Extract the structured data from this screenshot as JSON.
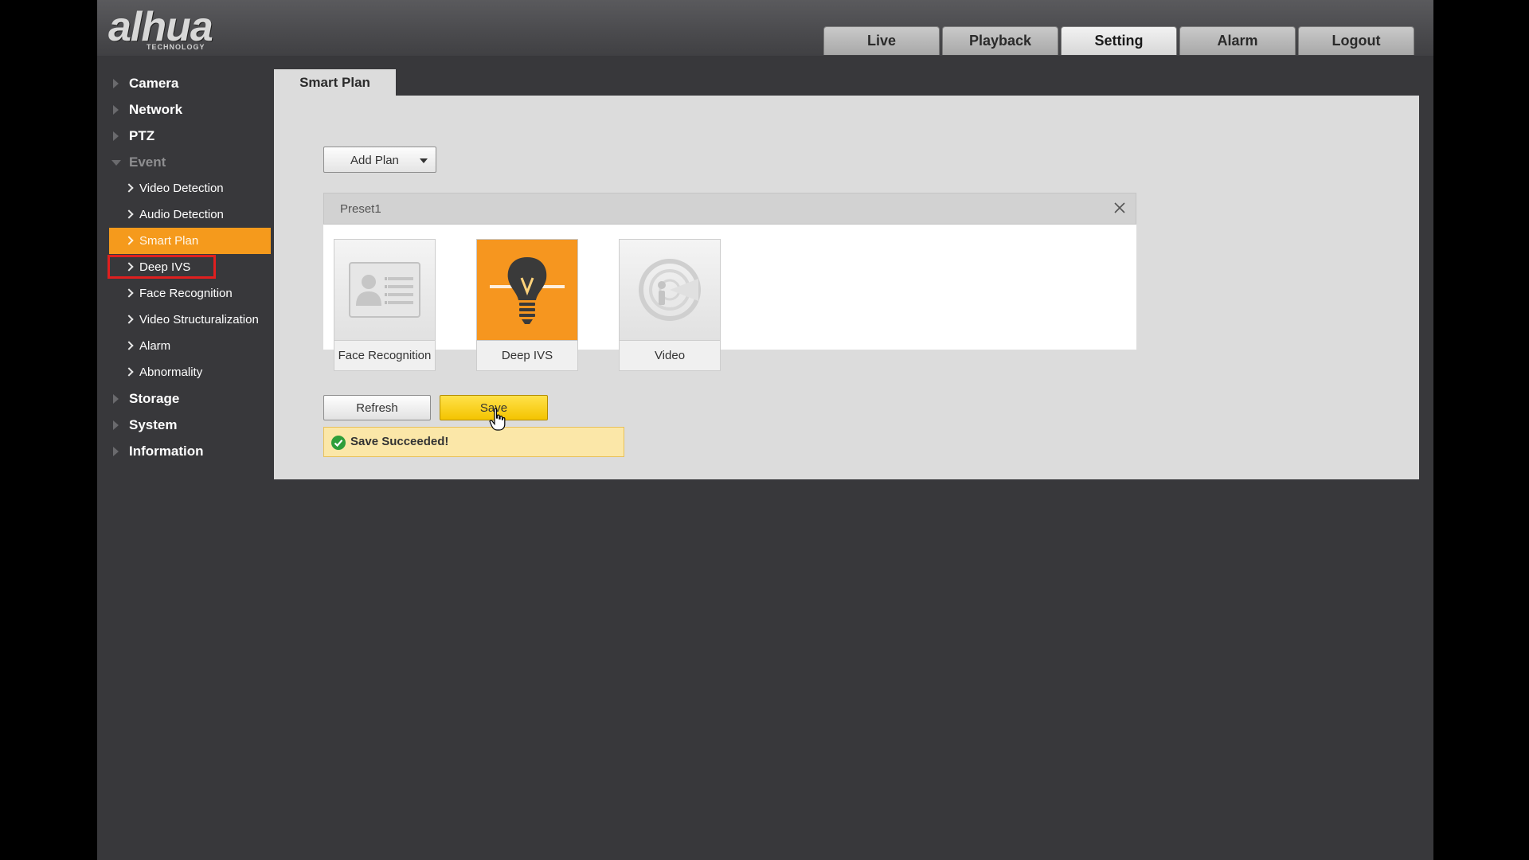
{
  "brand": {
    "name": "alhua",
    "tagline": "TECHNOLOGY"
  },
  "topnav": [
    {
      "label": "Live",
      "active": false
    },
    {
      "label": "Playback",
      "active": false
    },
    {
      "label": "Setting",
      "active": true
    },
    {
      "label": "Alarm",
      "active": false
    },
    {
      "label": "Logout",
      "active": false
    }
  ],
  "sidebar": {
    "sections": [
      {
        "label": "Camera"
      },
      {
        "label": "Network"
      },
      {
        "label": "PTZ"
      },
      {
        "label": "Event",
        "expanded": true
      }
    ],
    "event_items": [
      {
        "label": "Video Detection"
      },
      {
        "label": "Audio Detection"
      },
      {
        "label": "Smart Plan",
        "active": true
      },
      {
        "label": "Deep IVS",
        "highlighted": true
      },
      {
        "label": "Face Recognition"
      },
      {
        "label": "Video Structuralization"
      },
      {
        "label": "Alarm"
      },
      {
        "label": "Abnormality"
      }
    ],
    "sections_after": [
      {
        "label": "Storage"
      },
      {
        "label": "System"
      },
      {
        "label": "Information"
      }
    ]
  },
  "content": {
    "tab_label": "Smart Plan",
    "add_plan_label": "Add Plan",
    "preset": {
      "title": "Preset1",
      "cards": [
        {
          "label": "Face Recognition",
          "icon": "face-recognition-icon",
          "selected": false
        },
        {
          "label": "Deep IVS",
          "icon": "lightbulb-icon",
          "selected": true
        },
        {
          "label": "Video",
          "icon": "video-metadata-icon",
          "selected": false
        }
      ]
    },
    "refresh_label": "Refresh",
    "save_label": "Save",
    "status_message": "Save Succeeded!"
  },
  "colors": {
    "accent_orange": "#f59a1c",
    "highlight_red": "#e01f1f",
    "save_yellow": "#f4c400",
    "success_green": "#2e9e3a"
  }
}
